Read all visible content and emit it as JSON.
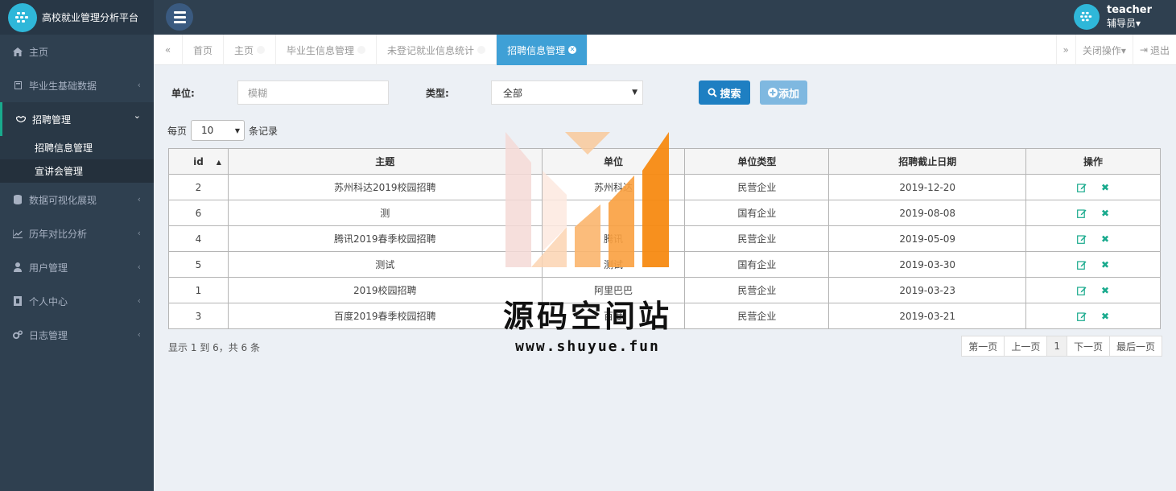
{
  "brand": {
    "title": "高校就业管理分析平台"
  },
  "sidebar": {
    "items": [
      {
        "label": "主页",
        "icon": "home-icon",
        "arrow": ""
      },
      {
        "label": "毕业生基础数据",
        "icon": "book-icon",
        "arrow": "‹"
      },
      {
        "label": "招聘管理",
        "icon": "handshake-icon",
        "arrow": "⌄"
      },
      {
        "label": "数据可视化展现",
        "icon": "database-icon",
        "arrow": "‹"
      },
      {
        "label": "历年对比分析",
        "icon": "line-chart-icon",
        "arrow": "‹"
      },
      {
        "label": "用户管理",
        "icon": "user-icon",
        "arrow": "‹"
      },
      {
        "label": "个人中心",
        "icon": "id-card-icon",
        "arrow": "‹"
      },
      {
        "label": "日志管理",
        "icon": "gears-icon",
        "arrow": "‹"
      }
    ],
    "submenu": [
      {
        "label": "招聘信息管理"
      },
      {
        "label": "宣讲会管理"
      }
    ]
  },
  "user": {
    "name": "teacher",
    "role": "辅导员▾"
  },
  "tabs": {
    "left_nav": "«",
    "items": [
      {
        "label": "首页"
      },
      {
        "label": "主页"
      },
      {
        "label": "毕业生信息管理"
      },
      {
        "label": "未登记就业信息统计"
      },
      {
        "label": "招聘信息管理"
      }
    ],
    "right_nav": "»",
    "close_ops": "关闭操作▾",
    "logout": "退出"
  },
  "filters": {
    "unit_label": "单位:",
    "unit_placeholder": "模糊",
    "type_label": "类型:",
    "type_value": "全部",
    "search_label": "搜索",
    "add_label": "添加"
  },
  "perpage": {
    "prefix": "每页",
    "value": "10",
    "suffix": "条记录"
  },
  "table": {
    "columns": [
      "id",
      "主题",
      "单位",
      "单位类型",
      "招聘截止日期",
      "操作"
    ],
    "rows": [
      {
        "id": "2",
        "topic": "苏州科达2019校园招聘",
        "unit": "苏州科达",
        "type": "民营企业",
        "deadline": "2019-12-20"
      },
      {
        "id": "6",
        "topic": "测",
        "unit": "",
        "type": "国有企业",
        "deadline": "2019-08-08"
      },
      {
        "id": "4",
        "topic": "腾讯2019春季校园招聘",
        "unit": "腾讯",
        "type": "民营企业",
        "deadline": "2019-05-09"
      },
      {
        "id": "5",
        "topic": "测试",
        "unit": "测试",
        "type": "国有企业",
        "deadline": "2019-03-30"
      },
      {
        "id": "1",
        "topic": "2019校园招聘",
        "unit": "阿里巴巴",
        "type": "民营企业",
        "deadline": "2019-03-23"
      },
      {
        "id": "3",
        "topic": "百度2019春季校园招聘",
        "unit": "百度",
        "type": "民营企业",
        "deadline": "2019-03-21"
      }
    ]
  },
  "summary": "显示 1 到 6，共 6 条",
  "pager": {
    "first": "第一页",
    "prev": "上一页",
    "current": "1",
    "next": "下一页",
    "last": "最后一页"
  },
  "watermark": {
    "text": "源码空间站",
    "url": "www.shuyue.fun"
  },
  "colors": {
    "sidebar": "#2f4050",
    "accent": "#3fa0d6",
    "search_btn": "#1e7fc2",
    "add_btn": "#7fb8e0",
    "delete_icon": "#19aa8d"
  }
}
